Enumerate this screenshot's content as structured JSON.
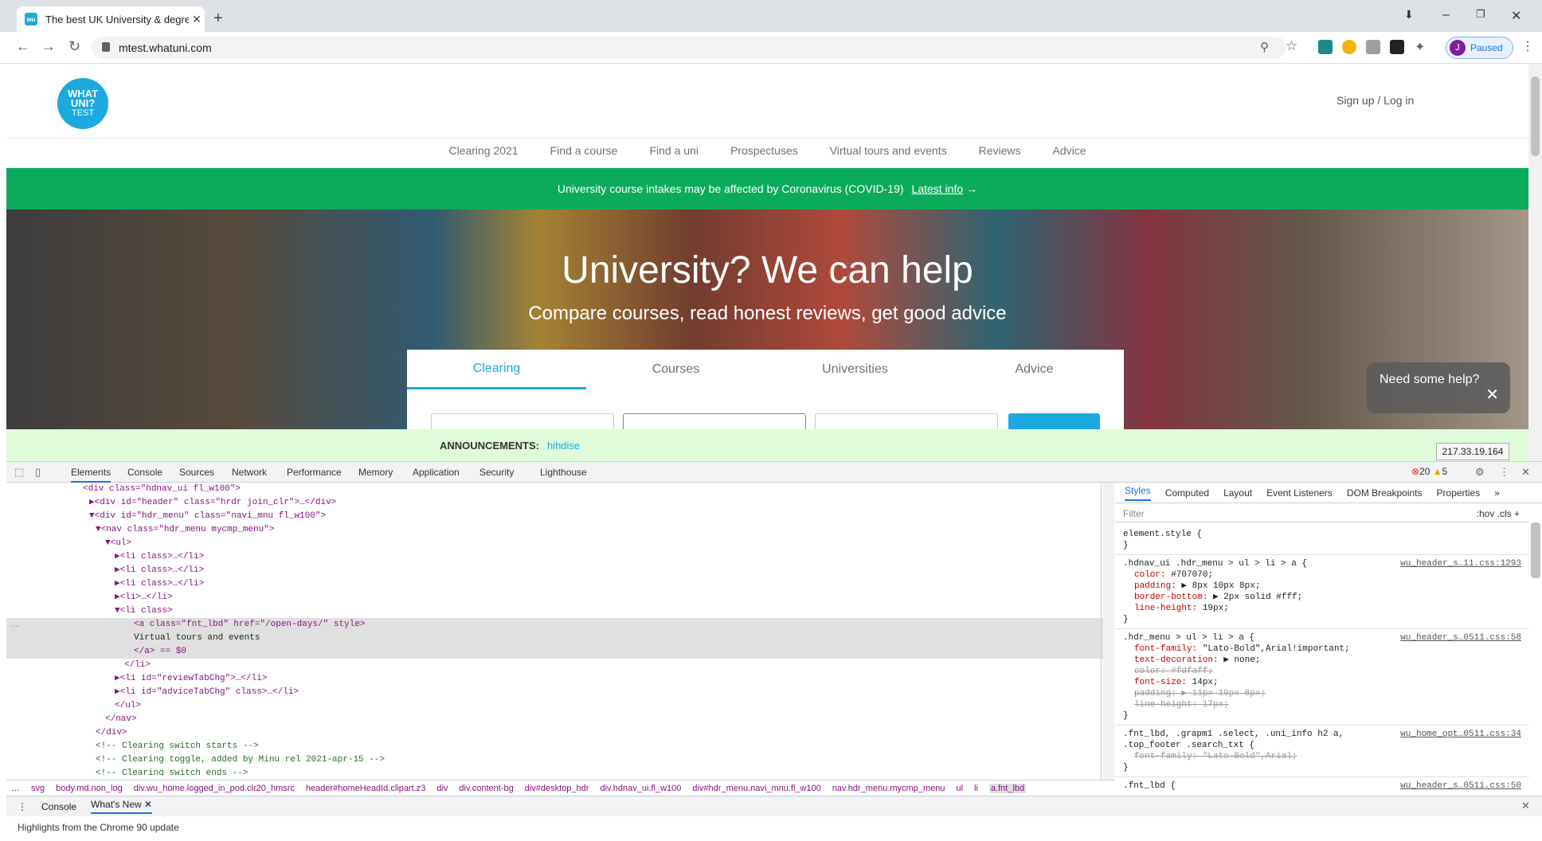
{
  "browser": {
    "tab_title": "The best UK University & degree",
    "favicon": "wu-icon",
    "url": "mtest.whatuni.com",
    "profile_initial": "J",
    "profile_status": "Paused",
    "window_controls": [
      "minimize-icon",
      "restore-icon",
      "close-icon"
    ]
  },
  "site": {
    "logo_lines": [
      "WHAT",
      "UNI?",
      "TEST"
    ],
    "signin": "Sign up / Log in",
    "nav": [
      "Clearing 2021",
      "Find a course",
      "Find a uni",
      "Prospectuses",
      "Virtual tours and events",
      "Reviews",
      "Advice"
    ],
    "covid_text": "University course intakes may be affected by Coronavirus (COVID-19)",
    "covid_link": "Latest info",
    "hero_title": "University? We can help",
    "hero_subtitle": "Compare courses, read honest reviews, get good advice",
    "search_tabs": [
      "Clearing",
      "Courses",
      "Universities",
      "Advice"
    ],
    "help_text": "Need some help?",
    "announce_label": "ANNOUNCEMENTS:",
    "announce_text": "hihdise",
    "ip_tooltip": "217.33.19.164"
  },
  "devtools": {
    "tabs": [
      "Elements",
      "Console",
      "Sources",
      "Network",
      "Performance",
      "Memory",
      "Application",
      "Security",
      "Lighthouse"
    ],
    "errors": "20",
    "warnings": "5",
    "styles_tabs": [
      "Styles",
      "Computed",
      "Layout",
      "Event Listeners",
      "DOM Breakpoints",
      "Properties"
    ],
    "filter_placeholder": "Filter",
    "filter_tools": ":hov  .cls  +",
    "breadcrumbs": [
      "svg",
      "body.md.non_log",
      "div.wu_home.logged_in_pod.clr20_hmsrc",
      "header#homeHeadId.clipart.z3",
      "div",
      "div.content-bg",
      "div#desktop_hdr",
      "div.hdnav_ui.fl_w100",
      "div#hdr_menu.navi_mnu.fl_w100",
      "nav.hdr_menu.mycmp_menu",
      "ul",
      "li",
      "a.fnt_lbd"
    ],
    "drawer_tabs": [
      "Console",
      "What's New"
    ],
    "drawer_message": "Highlights from the Chrome 90 update",
    "dom_lines": [
      "<div class=\"hdnav_ui fl_w100\">",
      "▶<div id=\"header\" class=\"hrdr join_clr\">…</div>",
      "▼<div id=\"hdr_menu\" class=\"navi_mnu fl_w100\">",
      "▼<nav class=\"hdr_menu mycmp_menu\">",
      "▼<ul>",
      "▶<li class>…</li>",
      "▶<li class>…</li>",
      "▶<li class>…</li>",
      "▶<li>…</li>",
      "▼<li class>",
      "<a class=\"fnt_lbd\" href=\"/open-days/\" style>",
      "Virtual tours and events",
      "</a> == $0",
      "</li>",
      "▶<li id=\"reviewTabChg\">…</li>",
      "▶<li id=\"adviceTabChg\" class>…</li>",
      "</ul>",
      "</nav>",
      "</div>",
      "<!-- Clearing switch starts -->",
      "<!-- Clearing toggle, added by Minu rel 2021-apr-15 -->",
      "<!-- Clearing switch ends -->"
    ],
    "rules": [
      {
        "selector": "element.style {",
        "source": "",
        "props": [],
        "close": "}"
      },
      {
        "selector": ".hdnav_ui .hdr_menu > ul > li > a {",
        "source": "wu_header_s…11.css:1293",
        "props": [
          [
            "color",
            "#707070;",
            false
          ],
          [
            "padding",
            "▶ 8px 10px 8px;",
            false
          ],
          [
            "border-bottom",
            "▶ 2px solid #fff;",
            false
          ],
          [
            "line-height",
            "19px;",
            false
          ]
        ],
        "close": "}"
      },
      {
        "selector": ".hdr_menu > ul > li > a {",
        "source": "wu_header_s…0511.css:58",
        "props": [
          [
            "font-family",
            "\"Lato-Bold\",Arial!important;",
            false
          ],
          [
            "text-decoration",
            "▶ none;",
            false
          ],
          [
            "color",
            "#fdfaff;",
            true
          ],
          [
            "font-size",
            "14px;",
            false
          ],
          [
            "padding",
            "▶ 11px 10px 8px;",
            true
          ],
          [
            "line-height",
            "17px;",
            true
          ]
        ],
        "close": "}"
      },
      {
        "selector": ".fnt_lbd, .grapm1 .select, .uni_info h2 a,\n.top_footer .search_txt {",
        "source": "wu_home_opt…0511.css:34",
        "props": [
          [
            "font-family",
            "\"Lato-Bold\",Arial;",
            true
          ]
        ],
        "close": "}"
      },
      {
        "selector": ".fnt_lbd {",
        "source": "wu_header_s…0511.css:50",
        "props": [],
        "close": ""
      }
    ]
  }
}
